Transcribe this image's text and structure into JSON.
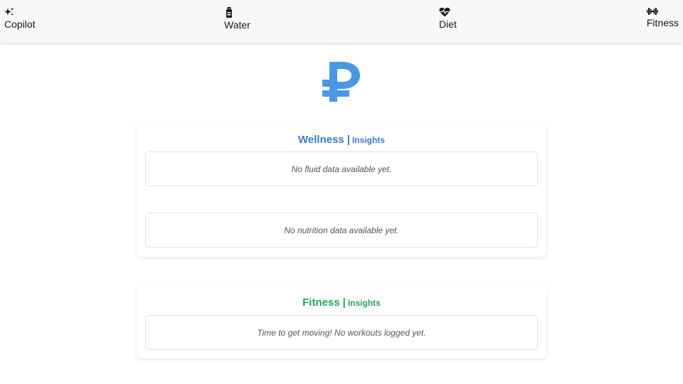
{
  "nav": {
    "items": [
      {
        "label": "Copilot",
        "icon": "sparkles-icon"
      },
      {
        "label": "Water",
        "icon": "bottle-icon"
      },
      {
        "label": "Diet",
        "icon": "heart-pulse-icon"
      },
      {
        "label": "Fitness",
        "icon": "dumbbell-icon"
      }
    ]
  },
  "logo": {
    "icon": "ruble-logo-icon",
    "color": "#4a97e4"
  },
  "wellness": {
    "title": "Wellness",
    "separator": "|",
    "subtitle": "Insights",
    "color": "#3a78c8",
    "fluid_message": "No fluid data available yet.",
    "nutrition_message": "No nutrition data available yet."
  },
  "fitness": {
    "title": "Fitness",
    "separator": "|",
    "subtitle": "Insights",
    "color": "#22a559",
    "workouts_message": "Time to get moving! No workouts logged yet."
  }
}
